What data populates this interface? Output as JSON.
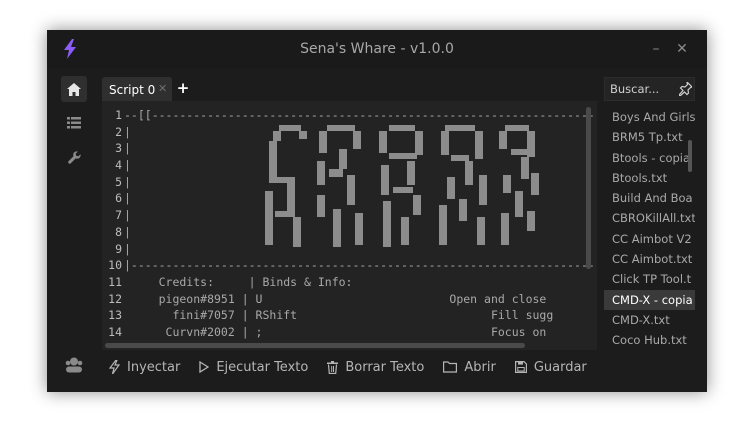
{
  "window": {
    "title": "Sena's Whare - v1.0.0",
    "minimize": "–",
    "close": "✕"
  },
  "sidebar": {
    "items": [
      "home-icon",
      "list-icon",
      "wrench-icon",
      "account-icon"
    ]
  },
  "tabs": {
    "items": [
      {
        "label": "Script 0",
        "close": "✕"
      }
    ],
    "add": "+"
  },
  "editor": {
    "line_numbers": [
      "1",
      "2",
      "3",
      "4",
      "5",
      "6",
      "7",
      "8",
      "9",
      "10",
      "11",
      "12",
      "13",
      "14"
    ],
    "lines": [
      "--[[-------------------------------------------------------------------",
      "|",
      "|",
      "|",
      "|",
      "|",
      "|",
      "|",
      "|",
      "|-------------------------------------------------------------------",
      "     Credits:     | Binds & Info:",
      "     pigeon#8951 | U                           Open and close",
      "       fini#7057 | RShift                            Fill sugg",
      "      Curvn#2002 | ;                                 Focus on"
    ]
  },
  "search": {
    "placeholder": "Buscar..."
  },
  "files": {
    "items": [
      "Boys And Girls",
      "BRM5 Tp.txt",
      "Btools - copia",
      "Btools.txt",
      "Build And Boa",
      "CBROKillAll.txt",
      "CC Aimbot V2",
      "CC Aimbot.txt",
      "Click TP Tool.t",
      "CMD-X - copia",
      "CMD-X.txt",
      "Coco Hub.txt"
    ],
    "selected": "CMD-X - copia"
  },
  "toolbar": {
    "inject": "Inyectar",
    "execute": "Ejecutar Texto",
    "clear": "Borrar Texto",
    "open": "Abrir",
    "save": "Guardar"
  },
  "colors": {
    "background": "#1c1c1c",
    "editor": "#232323",
    "accent": "#8b5cf6"
  }
}
